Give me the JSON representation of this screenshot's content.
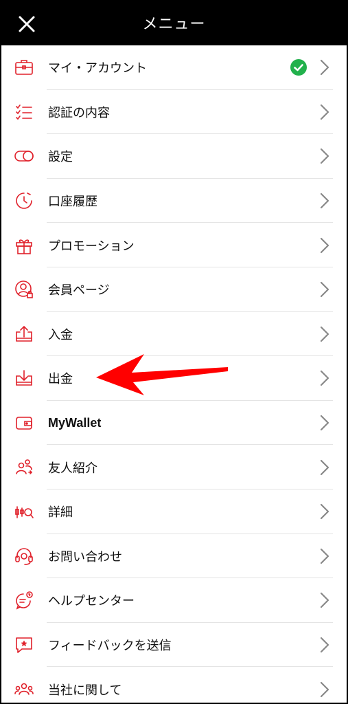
{
  "header": {
    "title": "メニュー"
  },
  "menu": [
    {
      "label": "マイ・アカウント",
      "verified": true
    },
    {
      "label": "認証の内容"
    },
    {
      "label": "設定"
    },
    {
      "label": "口座履歴"
    },
    {
      "label": "プロモーション"
    },
    {
      "label": "会員ページ"
    },
    {
      "label": "入金"
    },
    {
      "label": "出金"
    },
    {
      "label": "MyWallet"
    },
    {
      "label": "友人紹介"
    },
    {
      "label": "詳細"
    },
    {
      "label": "お問い合わせ"
    },
    {
      "label": "ヘルプセンター"
    },
    {
      "label": "フィードバックを送信"
    },
    {
      "label": "当社に関して"
    }
  ],
  "colors": {
    "accent": "#e0202a",
    "check": "#22b14c",
    "header_bg": "#000000"
  }
}
